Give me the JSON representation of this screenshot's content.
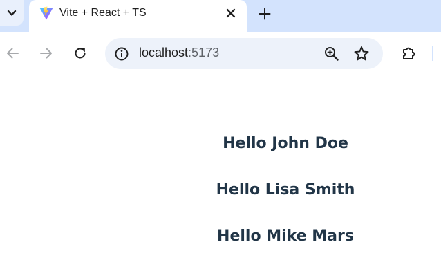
{
  "browser": {
    "tab": {
      "title": "Vite + React + TS"
    },
    "omnibox": {
      "host": "localhost",
      "port": ":5173"
    }
  },
  "page": {
    "greetings": [
      "Hello John Doe",
      "Hello Lisa Smith",
      "Hello Mike Mars"
    ]
  },
  "icons": {
    "tab_search": "chevron-down-icon",
    "favicon": "vite-logo-icon",
    "close": "close-icon",
    "new_tab": "plus-icon",
    "back": "back-arrow-icon",
    "forward": "forward-arrow-icon",
    "reload": "reload-icon",
    "site_info": "info-icon",
    "zoom": "zoom-in-icon",
    "bookmark": "star-icon",
    "extensions": "puzzle-icon"
  },
  "colors": {
    "tabstrip": "#d3e3fd",
    "omnibox": "#edf2fa",
    "heading": "#213547"
  }
}
